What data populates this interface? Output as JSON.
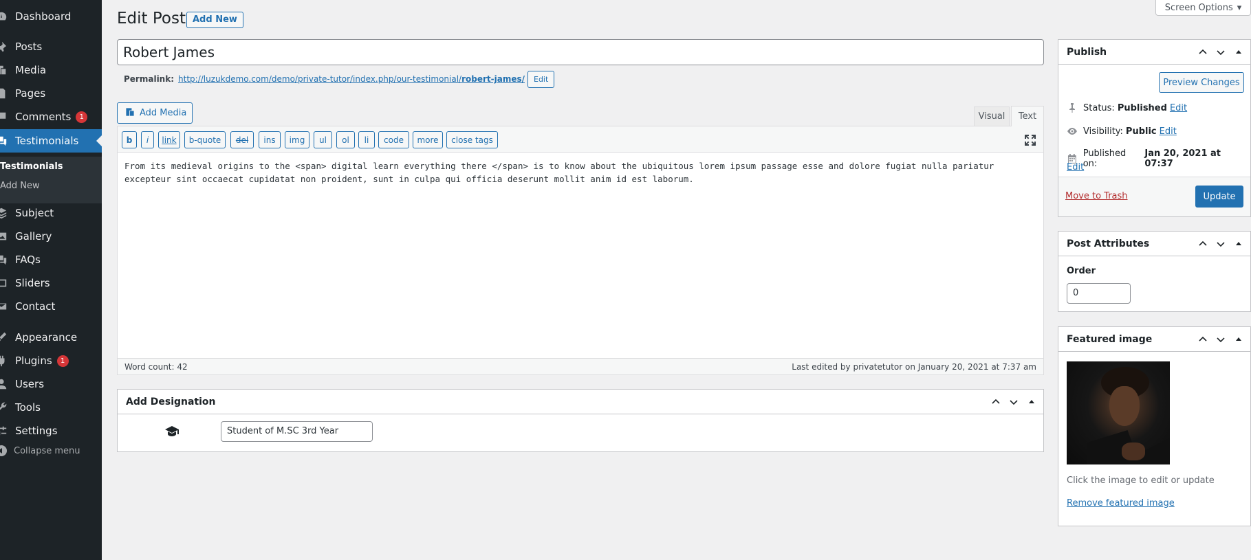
{
  "sidebar": {
    "items": [
      {
        "label": "Dashboard",
        "icon": "dashboard-icon"
      },
      {
        "label": "Posts",
        "icon": "pin-icon"
      },
      {
        "label": "Media",
        "icon": "media-icon"
      },
      {
        "label": "Pages",
        "icon": "pages-icon"
      },
      {
        "label": "Comments",
        "icon": "comments-icon",
        "badge": "1"
      },
      {
        "label": "Testimonials",
        "icon": "testimonial-icon",
        "active": true
      },
      {
        "label": "Subject",
        "icon": "layers-icon"
      },
      {
        "label": "Gallery",
        "icon": "gallery-icon"
      },
      {
        "label": "FAQs",
        "icon": "faq-icon"
      },
      {
        "label": "Sliders",
        "icon": "slider-icon"
      },
      {
        "label": "Contact",
        "icon": "mail-icon"
      },
      {
        "label": "Appearance",
        "icon": "brush-icon"
      },
      {
        "label": "Plugins",
        "icon": "plugin-icon",
        "badge": "1"
      },
      {
        "label": "Users",
        "icon": "users-icon"
      },
      {
        "label": "Tools",
        "icon": "wrench-icon"
      },
      {
        "label": "Settings",
        "icon": "settings-icon"
      }
    ],
    "submenu": [
      "Testimonials",
      "Add New"
    ],
    "collapse_label": "Collapse menu"
  },
  "header": {
    "title": "Edit Post",
    "add_new": "Add New",
    "screen_options": "Screen Options"
  },
  "post": {
    "title": "Robert James",
    "permalink_label": "Permalink:",
    "permalink_base": "http://luzukdemo.com/demo/private-tutor/index.php/our-testimonial/",
    "permalink_slug": "robert-james/",
    "permalink_edit": "Edit"
  },
  "editor": {
    "add_media": "Add Media",
    "tab_visual": "Visual",
    "tab_text": "Text",
    "quicktags": [
      "b",
      "i",
      "link",
      "b-quote",
      "del",
      "ins",
      "img",
      "ul",
      "ol",
      "li",
      "code",
      "more",
      "close tags"
    ],
    "content_line1": "From its medieval origins to the <span> digital learn everything there </span> is to know about the ubiquitous lorem ipsum passage esse and dolore fugiat nulla pariatur",
    "content_line2": "excepteur sint occaecat cupidatat non proident, sunt in culpa qui officia deserunt mollit anim id est laborum.",
    "word_count": "Word count: 42",
    "last_edited": "Last edited by privatetutor on January 20, 2021 at 7:37 am"
  },
  "designation": {
    "title": "Add Designation",
    "value": "Student of M.SC 3rd Year"
  },
  "publish": {
    "title": "Publish",
    "preview": "Preview Changes",
    "status_label": "Status:",
    "status_value": "Published",
    "visibility_label": "Visibility:",
    "visibility_value": "Public",
    "published_label": "Published on:",
    "published_value": "Jan 20, 2021 at 07:37",
    "edit": "Edit",
    "trash": "Move to Trash",
    "update": "Update"
  },
  "attributes": {
    "title": "Post Attributes",
    "order_label": "Order",
    "order_value": "0"
  },
  "featured": {
    "title": "Featured image",
    "caption": "Click the image to edit or update",
    "remove": "Remove featured image"
  },
  "colors": {
    "sidebar_bg": "#1d2327",
    "accent": "#2271b1",
    "badge": "#d63638",
    "trash": "#b32d2e"
  }
}
